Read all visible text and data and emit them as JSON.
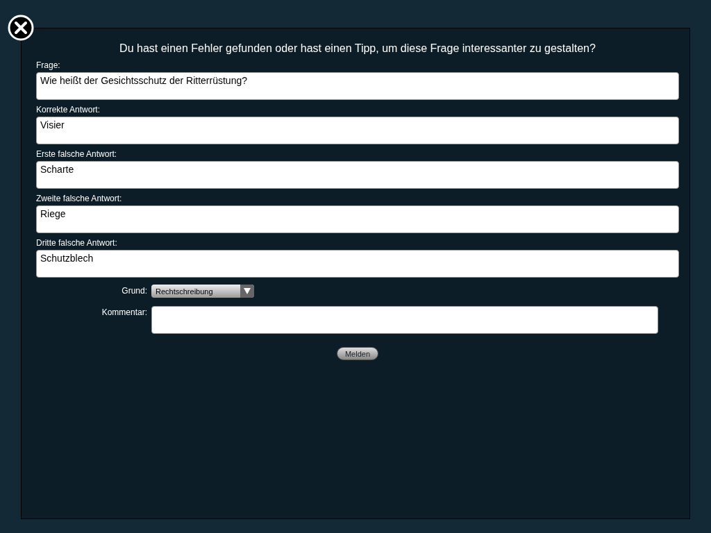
{
  "dialog": {
    "title": "Du hast einen Fehler gefunden oder hast einen Tipp, um diese Frage interessanter zu gestalten?",
    "fields": [
      {
        "label": "Frage:",
        "value": "Wie heißt der Gesichtsschutz der Ritterrüstung?"
      },
      {
        "label": "Korrekte Antwort:",
        "value": "Visier"
      },
      {
        "label": "Erste falsche Antwort:",
        "value": "Scharte"
      },
      {
        "label": "Zweite falsche Antwort:",
        "value": "Riege"
      },
      {
        "label": "Dritte falsche Antwort:",
        "value": "Schutzblech"
      }
    ],
    "reason": {
      "label": "Grund:",
      "value": "Rechtschreibung"
    },
    "comment": {
      "label": "Kommentar:"
    },
    "submit": "Melden"
  }
}
